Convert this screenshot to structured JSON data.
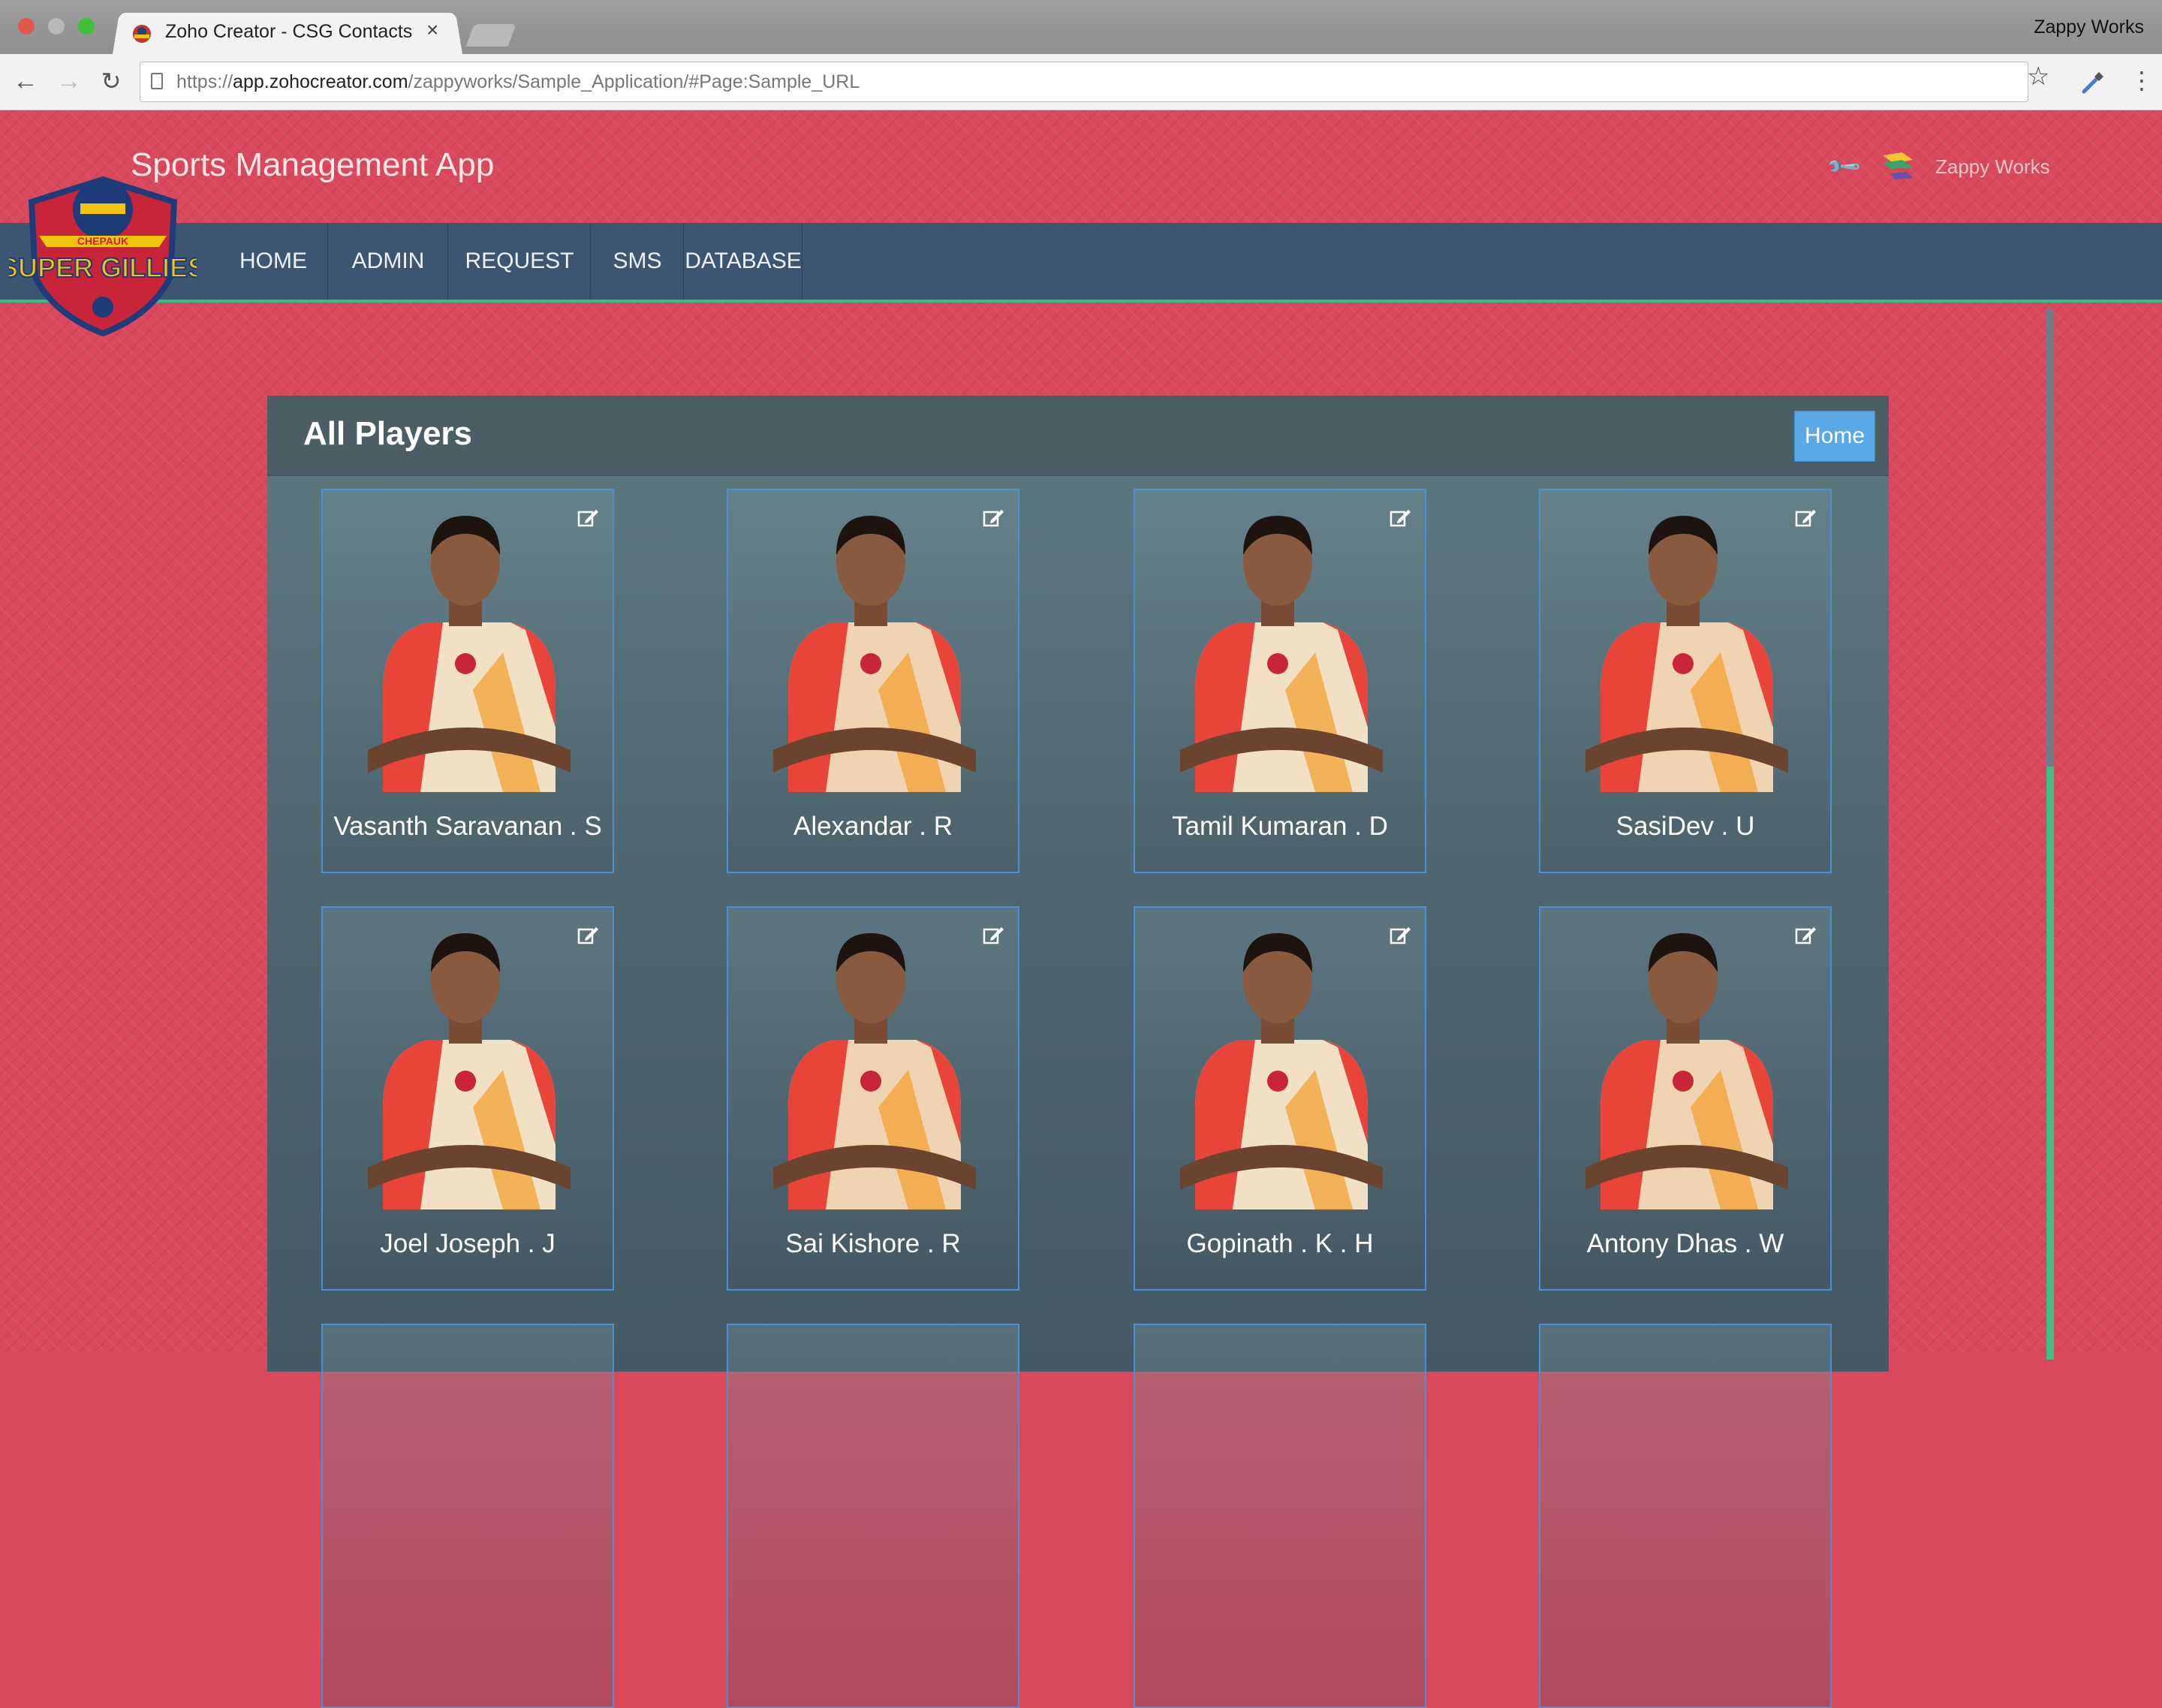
{
  "browser": {
    "tab_title": "Zoho Creator - CSG Contacts",
    "tab_close": "×",
    "profile_name": "Zappy Works",
    "url_prefix": "https://",
    "url_host": "app.zohocreator.com",
    "url_path": "/zappyworks/Sample_Application/#Page:Sample_URL"
  },
  "app": {
    "title": "Sports Management App",
    "user_name": "Zappy Works",
    "logo_top_text": "CHEPAUK",
    "logo_main_text": "SUPER GILLIES",
    "nav": [
      "HOME",
      "ADMIN",
      "REQUEST",
      "SMS",
      "DATABASE"
    ]
  },
  "panel": {
    "title": "All Players",
    "home_button": "Home",
    "players": [
      "Vasanth Saravanan . S",
      "Alexandar . R",
      "Tamil Kumaran . D",
      "SasiDev . U",
      "Joel Joseph . J",
      "Sai Kishore . R",
      "Gopinath . K . H",
      "Antony Dhas . W"
    ]
  },
  "colors": {
    "background": "#d9485c",
    "navbar": "#3c5672",
    "nav_underline": "#2ec27e",
    "card_border": "#4a90d9",
    "home_button": "#5aa9e6"
  }
}
